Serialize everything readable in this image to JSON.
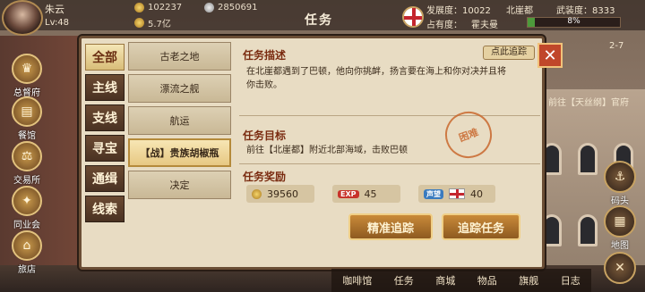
{
  "player": {
    "name": "朱云",
    "level": "Lv:48"
  },
  "stats": {
    "gold": "102237",
    "silver": "2850691",
    "cash": "5.7亿"
  },
  "screen_title": "任务",
  "top_info": {
    "development_label": "发展度：10022",
    "port": "北崖都",
    "military_label": "武装度：8333",
    "occupancy_label": "占有度：",
    "occupancy_owner": "霍夫曼",
    "occupancy_percent": "8%",
    "occupancy_value": 0.08
  },
  "route_text": "前往【天丝纲】官府",
  "page_indicator": "2-7",
  "side_menu": [
    {
      "label": "总督府",
      "icon": "crown-icon"
    },
    {
      "label": "餐馆",
      "icon": "bread-icon"
    },
    {
      "label": "交易所",
      "icon": "scale-icon"
    },
    {
      "label": "同业会",
      "icon": "handshake-icon"
    },
    {
      "label": "旅店",
      "icon": "bed-icon"
    }
  ],
  "right_menu": [
    {
      "label": "码头",
      "icon": "anchor-icon"
    },
    {
      "label": "地图",
      "icon": "map-icon"
    }
  ],
  "categories": [
    "全部",
    "主线",
    "支线",
    "寻宝",
    "通缉",
    "线索"
  ],
  "active_category": 0,
  "quests": [
    "古老之地",
    "漂流之舰",
    "航运",
    "【战】贵族胡椒瓶",
    "决定"
  ],
  "active_quest": 3,
  "detail": {
    "track_link": "点此追踪",
    "description_title": "任务描述",
    "description": "在北崖都遇到了巴顿，他向你挑衅，扬言要在海上和你对决并且将你击败。",
    "goal_title": "任务目标",
    "goal": "前往【北崖都】附近北部海域，击败巴顿",
    "difficulty_stamp": "困难",
    "reward_title": "任务奖励",
    "rewards": {
      "coins": "39560",
      "exp_tag": "EXP",
      "exp": "45",
      "rep_tag": "声望",
      "rep": "40"
    },
    "precise_track_button": "精准追踪",
    "track_quest_button": "追踪任务"
  },
  "bottom_nav": [
    "咖啡馆",
    "任务",
    "商城",
    "物品",
    "旗舰",
    "日志"
  ],
  "colors": {
    "accent": "#7a2b10",
    "panel": "#e8dcc3",
    "button": "#c98a3a"
  }
}
